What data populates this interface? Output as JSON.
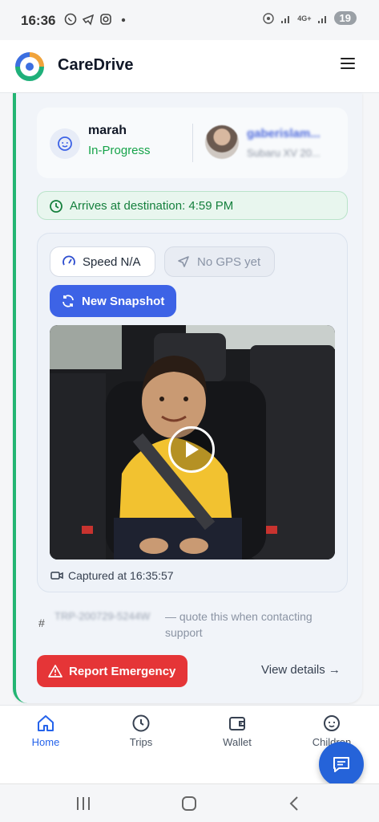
{
  "status_bar": {
    "time": "16:36",
    "battery": "19",
    "network": "4G+"
  },
  "app": {
    "title": "CareDrive"
  },
  "trip": {
    "child_name": "marah",
    "status": "In-Progress",
    "driver_name": "gaberislam...",
    "driver_car": "Subaru XV 20...",
    "eta": "Arrives at destination: 4:59 PM",
    "speed_chip": "Speed N/A",
    "gps_chip": "No GPS yet",
    "snapshot_button": "New Snapshot",
    "captured_at": "Captured at 16:35:57",
    "ref_hash": "#",
    "ref_code": "TRP-200729-5244W",
    "ref_note": "— quote this when contacting support",
    "emergency_button": "Report Emergency",
    "view_details": "View details →"
  },
  "nav": {
    "items": [
      {
        "label": "Home",
        "icon": "home-icon",
        "active": true
      },
      {
        "label": "Trips",
        "icon": "clock-icon",
        "active": false
      },
      {
        "label": "Wallet",
        "icon": "wallet-icon",
        "active": false
      },
      {
        "label": "Children",
        "icon": "child-face-icon",
        "active": false
      }
    ]
  },
  "colors": {
    "accent": "#3d63e6",
    "success": "#16a34a",
    "danger": "#e53537",
    "card_border": "#22b573"
  }
}
